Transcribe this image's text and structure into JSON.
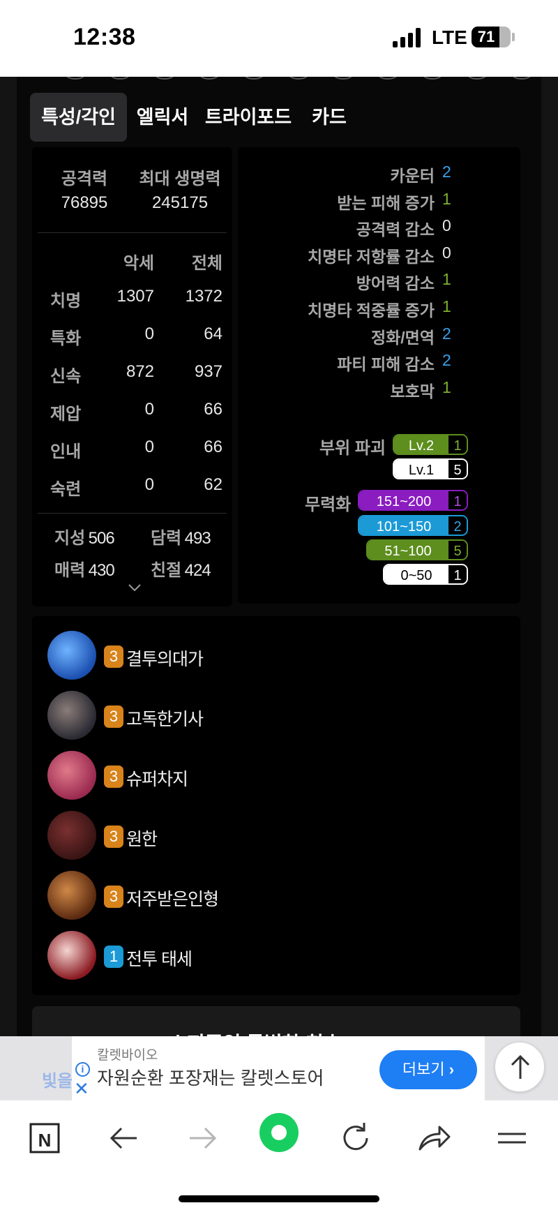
{
  "status": {
    "time": "12:38",
    "network": "LTE",
    "battery": "71",
    "battery_level": 0.71
  },
  "tabs": [
    {
      "label": "특성/각인",
      "active": true
    },
    {
      "label": "엘릭서"
    },
    {
      "label": "트라이포드"
    },
    {
      "label": "카드"
    }
  ],
  "basic": {
    "attack_label": "공격력",
    "attack_value": "76895",
    "hp_label": "최대 생명력",
    "hp_value": "245175"
  },
  "stats": {
    "headers": {
      "acc": "악세",
      "total": "전체"
    },
    "rows": [
      {
        "name": "치명",
        "acc": "1307",
        "total": "1372"
      },
      {
        "name": "특화",
        "acc": "0",
        "total": "64"
      },
      {
        "name": "신속",
        "acc": "872",
        "total": "937"
      },
      {
        "name": "제압",
        "acc": "0",
        "total": "66"
      },
      {
        "name": "인내",
        "acc": "0",
        "total": "66"
      },
      {
        "name": "숙련",
        "acc": "0",
        "total": "62"
      }
    ]
  },
  "traits": [
    {
      "name": "지성",
      "value": "506"
    },
    {
      "name": "담력",
      "value": "493"
    },
    {
      "name": "매력",
      "value": "430"
    },
    {
      "name": "친절",
      "value": "424"
    }
  ],
  "effects": [
    {
      "label": "카운터",
      "value": "2",
      "color": "#3aa0e8"
    },
    {
      "label": "받는 피해 증가",
      "value": "1",
      "color": "#7fb02e"
    },
    {
      "label": "공격력 감소",
      "value": "0",
      "color": "#e8e8e8"
    },
    {
      "label": "치명타 저항률 감소",
      "value": "0",
      "color": "#e8e8e8"
    },
    {
      "label": "방어력 감소",
      "value": "1",
      "color": "#7fb02e"
    },
    {
      "label": "치명타 적중률 증가",
      "value": "1",
      "color": "#7fb02e"
    },
    {
      "label": "정화/면역",
      "value": "2",
      "color": "#3aa0e8"
    },
    {
      "label": "파티 피해 감소",
      "value": "2",
      "color": "#3aa0e8"
    },
    {
      "label": "보호막",
      "value": "1",
      "color": "#7fb02e"
    }
  ],
  "part_break": {
    "label": "부위 파괴",
    "levels": [
      {
        "name": "Lv.2",
        "count": "1",
        "color": "#5d8e1e"
      },
      {
        "name": "Lv.1",
        "count": "5",
        "color": "#ffffff"
      }
    ]
  },
  "stagger": {
    "label": "무력화",
    "levels": [
      {
        "name": "151~200",
        "count": "1",
        "color": "#8a1cc0"
      },
      {
        "name": "101~150",
        "count": "2",
        "color": "#1b9ad6"
      },
      {
        "name": "51~100",
        "count": "5",
        "color": "#5d8e1e"
      },
      {
        "name": "0~50",
        "count": "1",
        "color": "#ffffff"
      }
    ]
  },
  "engravings": [
    {
      "level": "3",
      "name": "결투의대가",
      "badge_color": "#d9831b",
      "icon": "duel-master-icon"
    },
    {
      "level": "3",
      "name": "고독한기사",
      "badge_color": "#d9831b",
      "icon": "lone-knight-icon"
    },
    {
      "level": "3",
      "name": "슈퍼차지",
      "badge_color": "#d9831b",
      "icon": "super-charge-icon"
    },
    {
      "level": "3",
      "name": "원한",
      "badge_color": "#d9831b",
      "icon": "grudge-icon"
    },
    {
      "level": "3",
      "name": "저주받은인형",
      "badge_color": "#d9831b",
      "icon": "cursed-doll-icon"
    },
    {
      "level": "1",
      "name": "전투 태세",
      "badge_color": "#1b9ad6",
      "icon": "battle-stance-icon"
    }
  ],
  "special_title": {
    "label": "소지중인 특별한 칭호"
  },
  "ad": {
    "left_text": "빛을",
    "brand": "칼렛바이오",
    "text": "자원순환 포장재는 칼렛스토어",
    "button": "더보기"
  }
}
